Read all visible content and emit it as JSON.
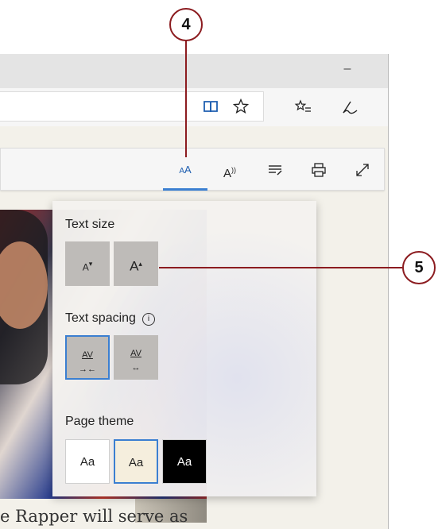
{
  "callouts": {
    "top": "4",
    "right": "5"
  },
  "titlebar": {
    "minimize_glyph": "–"
  },
  "address_bar": {
    "reading_view_icon": "book-icon",
    "favorite_icon": "star-icon"
  },
  "toolbar": {
    "favorites_icon": "favorites-list-icon",
    "notes_icon": "pen-icon"
  },
  "reading_toolbar": {
    "buttons": [
      {
        "name": "text-options",
        "glyph": "AA"
      },
      {
        "name": "read-aloud",
        "glyph": "A⁾"
      },
      {
        "name": "learning-tools",
        "glyph": "≡"
      },
      {
        "name": "print",
        "glyph": "⎙"
      },
      {
        "name": "fullscreen",
        "glyph": "⤢"
      }
    ]
  },
  "panel": {
    "text_size_label": "Text size",
    "text_spacing_label": "Text spacing",
    "info_glyph": "i",
    "page_theme_label": "Page theme",
    "size_decrease": "A",
    "size_increase": "A",
    "spacing_narrow": "AV",
    "spacing_wide": "AV",
    "themes": [
      {
        "label": "Aa",
        "bg": "#ffffff",
        "fg": "#222222",
        "selected": false
      },
      {
        "label": "Aa",
        "bg": "#f5eedd",
        "fg": "#222222",
        "selected": true
      },
      {
        "label": "Aa",
        "bg": "#000000",
        "fg": "#ffffff",
        "selected": false
      }
    ]
  },
  "article": {
    "visible_text": "e Rapper will serve as"
  },
  "colors": {
    "accent": "#3b7fd1",
    "callout": "#8c1c20"
  }
}
